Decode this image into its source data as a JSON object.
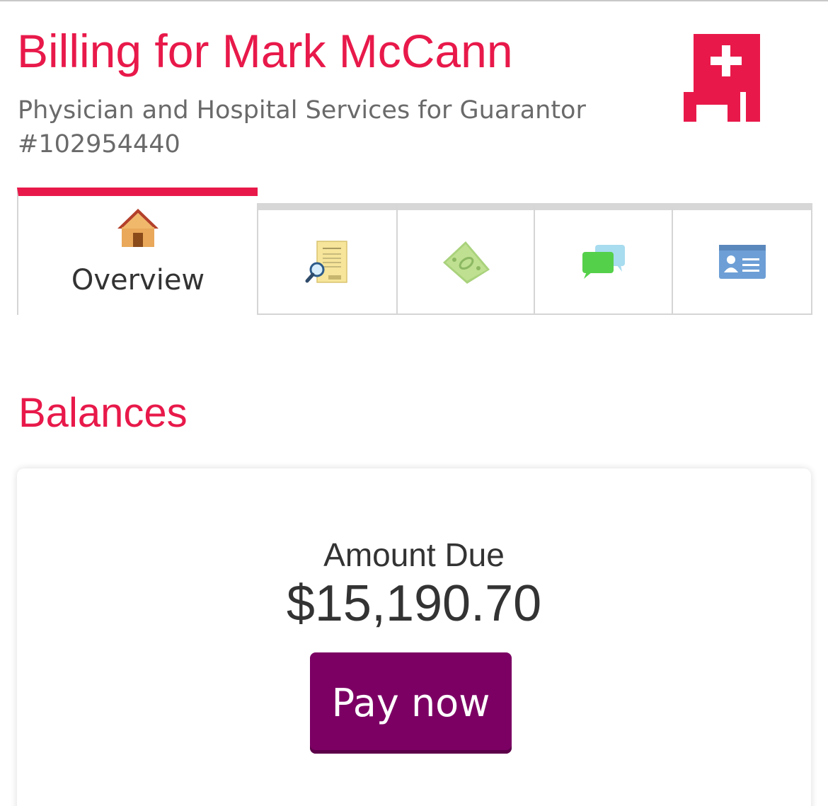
{
  "header": {
    "title": "Billing for Mark McCann",
    "subtitle": "Physician and Hospital Services for Guarantor #102954440",
    "logo_icon": "hospital-cross-logo-icon"
  },
  "tabs": [
    {
      "label": "Overview",
      "icon": "house-icon",
      "active": true
    },
    {
      "label": "",
      "icon": "invoice-search-icon",
      "active": false
    },
    {
      "label": "",
      "icon": "money-icon",
      "active": false
    },
    {
      "label": "",
      "icon": "chat-bubbles-icon",
      "active": false
    },
    {
      "label": "",
      "icon": "id-card-icon",
      "active": false
    }
  ],
  "balances": {
    "title": "Balances",
    "amount_label": "Amount Due",
    "amount_value": "$15,190.70",
    "pay_button": "Pay now"
  },
  "colors": {
    "brand": "#e8194a",
    "button": "#7c0064",
    "subtitle": "#6a6a6a"
  }
}
